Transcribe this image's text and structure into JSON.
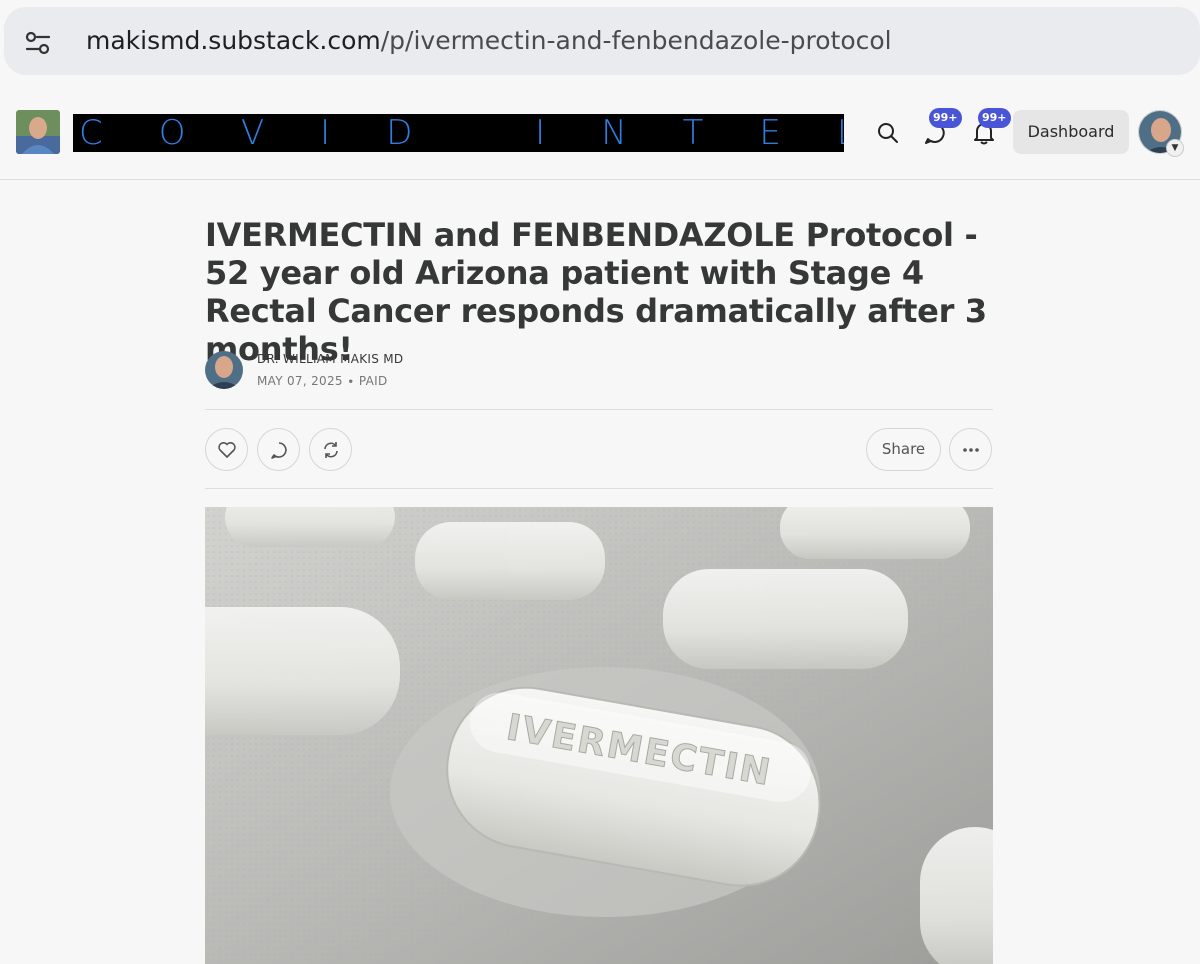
{
  "browser": {
    "url_host": "makismd.substack.com",
    "url_path": "/p/ivermectin-and-fenbendazole-protocol",
    "site_settings_icon": "tune-icon"
  },
  "site_header": {
    "banner_text": "COVID INTEL",
    "badges": {
      "chat": "99+",
      "notifications": "99+"
    },
    "dashboard_label": "Dashboard",
    "icons": [
      "search-icon",
      "chat-icon",
      "bell-icon",
      "chevron-down-icon"
    ]
  },
  "post": {
    "title": "IVERMECTIN and FENBENDAZOLE Protocol - 52 year old Arizona patient with Stage 4 Rectal Cancer responds dramatically after 3 months!",
    "author": "DR. WILLIAM MAKIS MD",
    "date": "MAY 07, 2025",
    "access": "PAID",
    "meta_separator": "∙",
    "share_label": "Share",
    "action_icons": [
      "heart-icon",
      "comment-icon",
      "restack-icon",
      "more-icon"
    ]
  },
  "hero_image": {
    "pill_imprint": "IVERMECTIN",
    "accent_color": "#2f7ee0",
    "badge_color": "#4a55d6"
  }
}
